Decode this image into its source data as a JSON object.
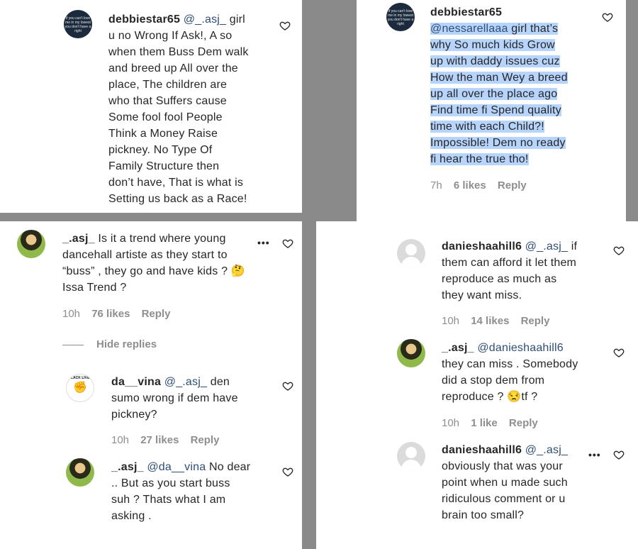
{
  "panel1": {
    "user": "debbiestar65",
    "mention": "@_.asj_",
    "lines": [
      " girl",
      "u no Wrong If Ask!, A so",
      "when them Buss Dem walk",
      "and breed up All over the",
      "place, The children are",
      "who that Suffers cause",
      "Some fool fool People",
      "Think a Money Raise",
      "pickney. No Type Of",
      "Family Structure then",
      "don’t have, That is what is",
      "Setting us back as a Race!"
    ],
    "avatar_text": "if you can't love me in my lowest you don't have a right"
  },
  "panel2": {
    "user": "debbiestar65",
    "mention": "@nessarellaaa",
    "lines": [
      " girl that’s",
      "why So much kids Grow",
      "up with daddy issues cuz",
      "How the man Wey a breed",
      "up all over the place ago",
      "Find time fi Spend quality",
      "time with each Child?!",
      "Impossible! Dem no ready",
      "fi hear the true tho!"
    ],
    "time": "7h",
    "likes": "6 likes",
    "reply": "Reply"
  },
  "panel3": {
    "c1": {
      "user": "_.asj_",
      "lines": [
        " Is it a trend where young",
        "dancehall artiste as they start to",
        "“buss” , they go and have kids ? 🤔",
        "Issa Trend ?"
      ],
      "time": "10h",
      "likes": "76 likes",
      "reply": "Reply"
    },
    "hide_replies": "Hide replies",
    "c2": {
      "user": "da__vina",
      "mention": "@_.asj_",
      "lines": [
        " den",
        "sumo wrong if dem have",
        "pickney?"
      ],
      "time": "10h",
      "likes": "27 likes",
      "reply": "Reply",
      "avatar_text": "BLACK LIVES"
    },
    "c3": {
      "user": "_.asj_",
      "mention": "@da__vina",
      "lines": [
        " No dear",
        ".. But as you start buss",
        "suh ? Thats what I am",
        "asking ."
      ]
    }
  },
  "panel4": {
    "c1": {
      "user": "danieshaahill6",
      "mention": "@_.asj_",
      "lines": [
        " if",
        "them can afford it let them",
        "reproduce as much as",
        "they want miss."
      ],
      "time": "10h",
      "likes": "14 likes",
      "reply": "Reply"
    },
    "c2": {
      "user": "_.asj_",
      "mention": "@danieshaahill6",
      "lines": [
        "they can miss . Somebody",
        "did a stop dem from",
        "reproduce ? 😒tf ?"
      ],
      "time": "10h",
      "likes": "1 like",
      "reply": "Reply"
    },
    "c3": {
      "user": "danieshaahill6",
      "mention": "@_.asj_",
      "lines": [
        "obviously that was your",
        "point when u made such",
        "ridiculous comment or u",
        "brain too small?"
      ]
    }
  },
  "icons": {
    "heart": "heart-icon",
    "more": "more-options-icon"
  },
  "colors": {
    "mention": "#2f4e76",
    "highlight": "#b6d4fc",
    "meta": "#8e8e8e"
  }
}
